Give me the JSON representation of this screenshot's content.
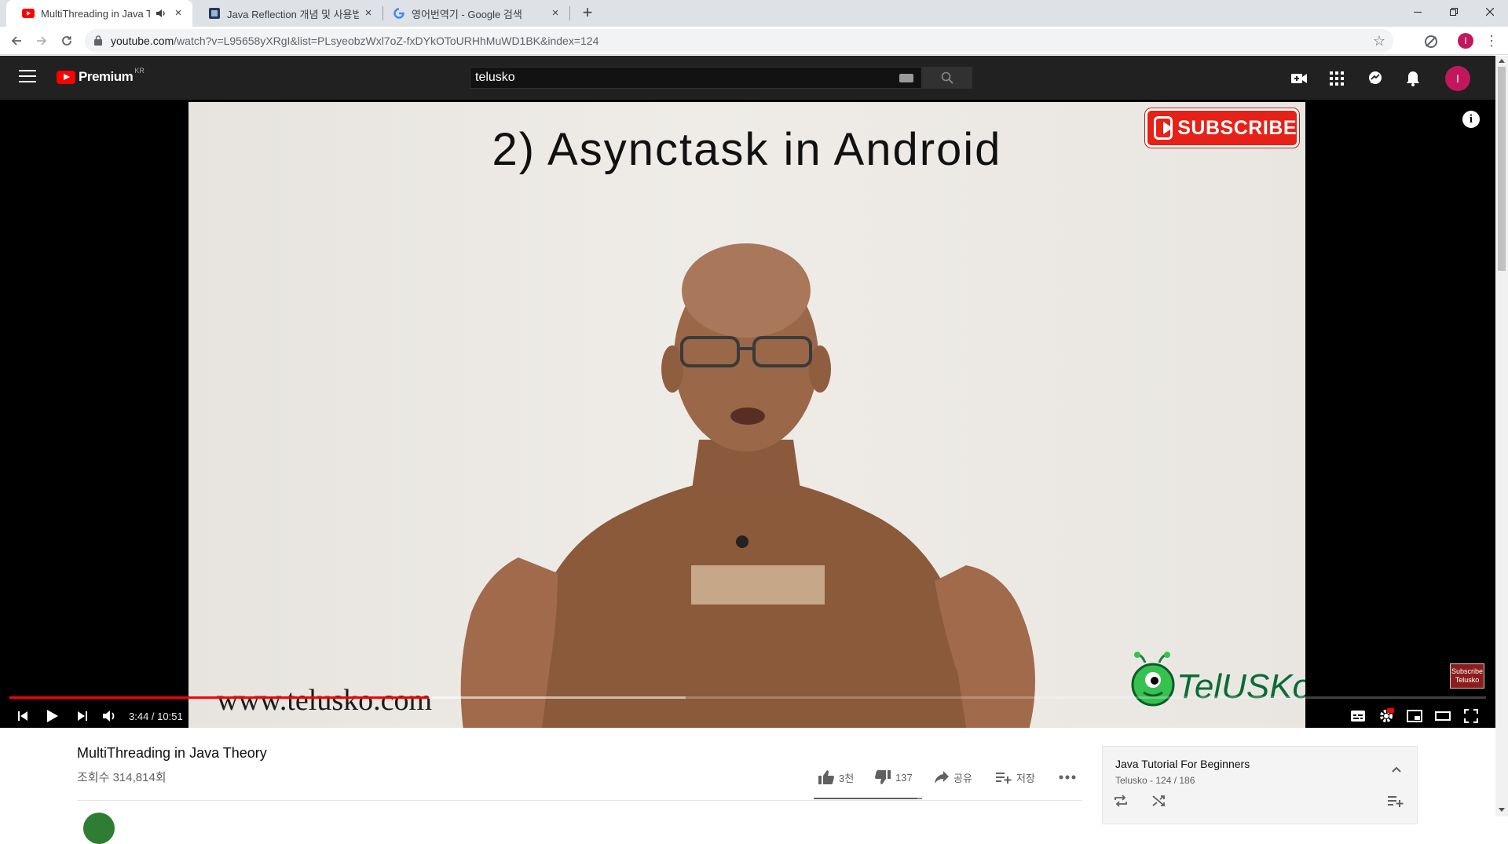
{
  "browser": {
    "tabs": [
      {
        "title": "MultiThreading in Java Theo",
        "favicon": "youtube-icon",
        "active": true
      },
      {
        "title": "Java Reflection 개념 및 사용법",
        "favicon": "blog-icon",
        "active": false
      },
      {
        "title": "영어번역기 - Google 검색",
        "favicon": "google-icon",
        "active": false
      }
    ],
    "close_glyph": "×",
    "new_tab_glyph": "+",
    "url_host": "youtube.com",
    "url_path": "/watch?v=L95658yXRgI&list=PLsyeobzWxl7oZ-fxDYkOToURHhMuWD1BK&index=124",
    "profile_initial": "I"
  },
  "masthead": {
    "logo_text": "Premium",
    "region": "KR",
    "search_value": "telusko",
    "avatar_initial": "I"
  },
  "player": {
    "frame_title": "2)  Asynctask  in  Android",
    "subscribe_badge": "SUBSCRIBE",
    "watermark_url": "www.telusko.com",
    "brand_logo": "TelUSKo",
    "endscreen_label": "Subscribe Telusko",
    "current_time": "3:44",
    "duration": "10:51",
    "time_display": "3:44 / 10:51",
    "played_fraction": 0.2842,
    "buffered_fraction": 0.4582,
    "info_glyph": "i"
  },
  "video": {
    "title": "MultiThreading in Java Theory",
    "views": "조회수 314,814회",
    "likes": "3천",
    "dislikes": "137",
    "share_label": "공유",
    "save_label": "저장",
    "like_fraction": 0.96
  },
  "playlist": {
    "title": "Java Tutorial For Beginners",
    "meta": "Telusko - 124 / 186"
  },
  "colors": {
    "accent": "#ff0000",
    "masthead_bg": "#212121",
    "avatar": "#c2185b"
  }
}
